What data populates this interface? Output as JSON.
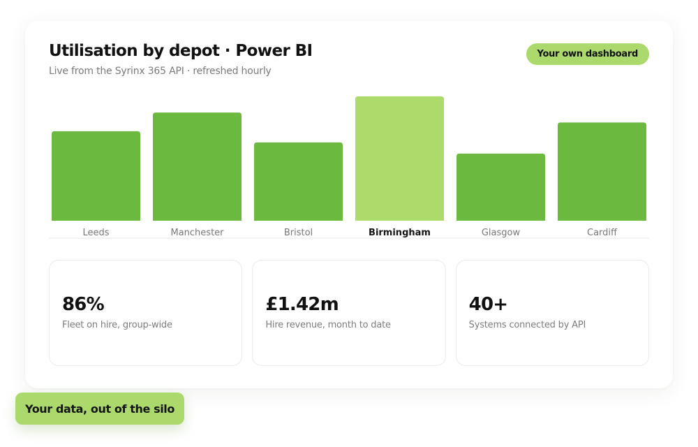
{
  "header": {
    "title": "Utilisation by depot · Power BI",
    "subtitle": "Live from the Syrinx 365 API · refreshed hourly",
    "tag": "Your own dashboard"
  },
  "chart_data": {
    "type": "bar",
    "categories": [
      "Leeds",
      "Manchester",
      "Bristol",
      "Birmingham",
      "Glasgow",
      "Cardiff"
    ],
    "values": [
      72,
      87,
      63,
      100,
      54,
      79
    ],
    "highlight_index": 3,
    "title": "",
    "xlabel": "",
    "ylabel": "",
    "ylim": [
      0,
      100
    ],
    "grid": false,
    "bar_color": "#6cb940",
    "highlight_color": "#addb6b",
    "axis_color": "#e6e6e6"
  },
  "stats": [
    {
      "value": "86%",
      "caption": "Fleet on hire, group-wide"
    },
    {
      "value": "£1.42m",
      "caption": "Hire revenue, month to date"
    },
    {
      "value": "40+",
      "caption": "Systems connected by API"
    }
  ],
  "footer": {
    "label": "Your data, out of the silo"
  },
  "colors": {
    "accent": "#acd96b",
    "bar": "#6cb940"
  }
}
